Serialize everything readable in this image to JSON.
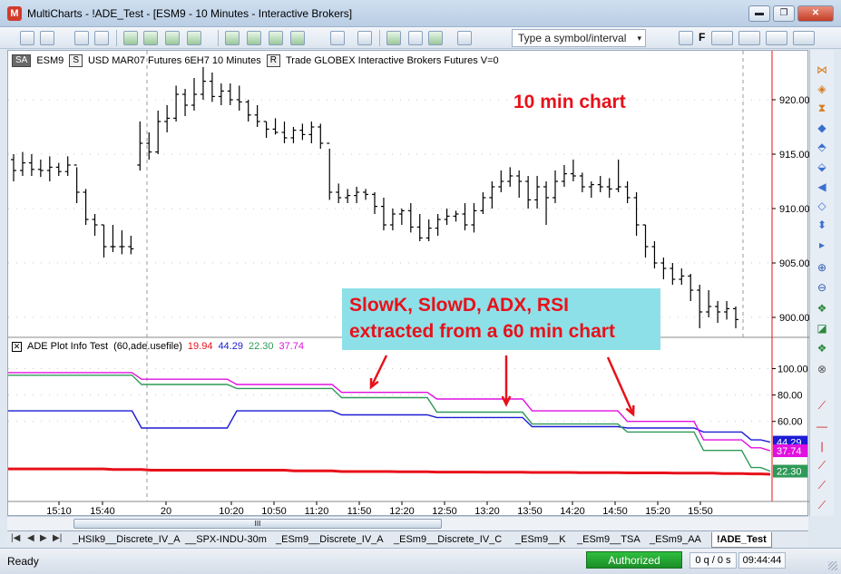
{
  "window": {
    "title": "MultiCharts - !ADE_Test - [ESM9 - 10 Minutes - Interactive Brokers]",
    "app_icon": "multicharts-logo-icon",
    "minimize": "▬",
    "restore": "❐",
    "close": "✕"
  },
  "toolbar": {
    "symbol_placeholder": "Type a symbol/interval",
    "dropdown_glyph": "▾",
    "extra_label": "F"
  },
  "chart_header": {
    "sa_button": "SA",
    "symbol": "ESM9",
    "s_button": "S",
    "description": "USD MAR07  Futures 6EH7  10 Minutes",
    "r_button": "R",
    "details": "Trade  GLOBEX  Interactive Brokers  Futures  V=0"
  },
  "annotations": {
    "title": "10 min chart",
    "box_line1": "SlowK, SlowD, ADX, RSI",
    "box_line2": "extracted from a 60 min chart"
  },
  "indicator": {
    "close_glyph": "✕",
    "name": "ADE Plot Info Test",
    "params": "(60,ade.usefile)",
    "values": [
      "19.94",
      "44.29",
      "22.30",
      "37.74"
    ],
    "colors": [
      "#e8111a",
      "#1b1bd6",
      "#2e9a58",
      "#e010e0"
    ]
  },
  "price_axis": [
    "920.00",
    "915.00",
    "910.00",
    "905.00",
    "900.00"
  ],
  "indicator_axis": [
    "100.00",
    "80.00",
    "60.00"
  ],
  "indicator_tags": {
    "adx": "44.29",
    "rsi": "37.74",
    "slowd": "22.30"
  },
  "time_axis": [
    "15:10",
    "15:40",
    "20",
    "10:20",
    "10:50",
    "11:20",
    "11:50",
    "12:20",
    "12:50",
    "13:20",
    "13:50",
    "14:20",
    "14:50",
    "15:20",
    "15:50"
  ],
  "chart_data": [
    {
      "type": "bar",
      "title": "",
      "xlabel": "",
      "ylabel": "",
      "ylim": [
        898.5,
        922.5
      ],
      "grid": true,
      "note": "OHLC price bars, ESM9 10 minutes",
      "bars": [
        [
          914.5,
          915.0,
          912.5,
          913.5
        ],
        [
          913.5,
          915.2,
          913.0,
          914.2
        ],
        [
          914.2,
          915.0,
          913.0,
          913.6
        ],
        [
          913.6,
          914.5,
          912.9,
          913.5
        ],
        [
          913.5,
          914.8,
          912.5,
          913.8
        ],
        [
          913.8,
          914.2,
          913.0,
          913.4
        ],
        [
          913.4,
          914.8,
          913.0,
          914.0
        ],
        [
          914.0,
          913.8,
          910.5,
          911.5
        ],
        [
          911.5,
          911.8,
          908.5,
          909.0
        ],
        [
          909.0,
          909.5,
          907.5,
          908.5
        ],
        [
          908.5,
          908.5,
          905.5,
          906.5
        ],
        [
          906.5,
          908.5,
          906.0,
          906.5
        ],
        [
          906.5,
          908.0,
          905.8,
          906.5
        ],
        [
          906.5,
          907.5,
          905.8,
          906.3
        ],
        [
          914.0,
          918.0,
          913.5,
          916.0
        ],
        [
          916.0,
          917.0,
          914.5,
          915.2
        ],
        [
          915.2,
          919.0,
          915.0,
          918.0
        ],
        [
          918.0,
          919.5,
          917.0,
          918.3
        ],
        [
          918.3,
          921.3,
          918.0,
          920.5
        ],
        [
          920.5,
          921.0,
          918.5,
          919.5
        ],
        [
          919.5,
          922.0,
          919.0,
          920.5
        ],
        [
          920.5,
          923.0,
          920.0,
          921.7
        ],
        [
          921.7,
          922.5,
          919.8,
          920.3
        ],
        [
          920.3,
          921.5,
          919.5,
          920.8
        ],
        [
          920.8,
          921.5,
          919.5,
          920.0
        ],
        [
          920.0,
          921.3,
          919.0,
          919.8
        ],
        [
          919.8,
          920.0,
          918.0,
          918.6
        ],
        [
          918.6,
          919.5,
          917.5,
          918.0
        ],
        [
          918.0,
          918.0,
          916.5,
          917.3
        ],
        [
          917.3,
          918.3,
          916.8,
          917.0
        ],
        [
          917.0,
          918.0,
          916.0,
          916.5
        ],
        [
          916.5,
          917.5,
          916.0,
          917.2
        ],
        [
          917.2,
          917.8,
          916.3,
          916.8
        ],
        [
          916.8,
          918.0,
          916.0,
          917.5
        ],
        [
          917.5,
          917.8,
          915.5,
          916.0
        ],
        [
          916.0,
          915.5,
          910.8,
          911.5
        ],
        [
          911.5,
          912.3,
          910.5,
          911.0
        ],
        [
          911.0,
          911.8,
          910.5,
          911.2
        ],
        [
          911.2,
          912.0,
          910.5,
          911.5
        ],
        [
          911.5,
          911.8,
          910.8,
          911.3
        ],
        [
          911.3,
          911.5,
          909.5,
          910.2
        ],
        [
          910.2,
          911.0,
          908.0,
          908.5
        ],
        [
          908.5,
          910.0,
          908.0,
          909.5
        ],
        [
          909.5,
          910.0,
          908.5,
          909.8
        ],
        [
          909.8,
          910.5,
          907.8,
          908.3
        ],
        [
          908.3,
          909.5,
          907.0,
          907.3
        ],
        [
          907.3,
          909.0,
          907.0,
          908.2
        ],
        [
          908.2,
          909.5,
          907.5,
          909.0
        ],
        [
          909.0,
          910.0,
          908.5,
          909.3
        ],
        [
          909.3,
          909.8,
          908.8,
          909.5
        ],
        [
          909.5,
          910.5,
          908.0,
          908.5
        ],
        [
          908.5,
          910.5,
          907.8,
          909.8
        ],
        [
          909.8,
          911.5,
          909.5,
          911.0
        ],
        [
          911.0,
          912.5,
          910.0,
          912.0
        ],
        [
          912.0,
          913.5,
          911.5,
          912.5
        ],
        [
          912.5,
          913.8,
          912.0,
          913.0
        ],
        [
          913.0,
          913.5,
          911.0,
          912.5
        ],
        [
          912.5,
          913.0,
          910.0,
          910.8
        ],
        [
          910.8,
          913.0,
          910.0,
          912.0
        ],
        [
          912.0,
          912.5,
          908.5,
          911.0
        ],
        [
          911.0,
          913.5,
          910.5,
          912.5
        ],
        [
          912.5,
          914.0,
          912.0,
          913.2
        ],
        [
          913.2,
          914.5,
          912.5,
          913.0
        ],
        [
          913.0,
          913.3,
          911.5,
          912.0
        ],
        [
          912.0,
          912.5,
          911.0,
          912.2
        ],
        [
          912.2,
          913.0,
          911.5,
          912.0
        ],
        [
          912.0,
          912.8,
          911.0,
          911.8
        ],
        [
          911.8,
          914.5,
          911.5,
          912.0
        ],
        [
          912.0,
          912.5,
          910.5,
          911.0
        ],
        [
          911.0,
          911.5,
          907.5,
          908.5
        ],
        [
          908.5,
          908.5,
          905.5,
          906.5
        ],
        [
          906.5,
          907.0,
          904.5,
          905.0
        ],
        [
          905.0,
          905.5,
          903.5,
          904.5
        ],
        [
          904.5,
          905.0,
          903.0,
          903.5
        ],
        [
          903.5,
          904.5,
          903.0,
          903.8
        ],
        [
          903.8,
          904.0,
          901.5,
          902.5
        ],
        [
          902.5,
          903.0,
          899.0,
          900.5
        ],
        [
          900.5,
          902.5,
          900.0,
          901.0
        ],
        [
          901.0,
          901.5,
          899.5,
          900.5
        ],
        [
          900.5,
          901.5,
          899.8,
          900.8
        ],
        [
          900.8,
          901.0,
          899.0,
          899.8
        ]
      ]
    },
    {
      "type": "line",
      "title": "",
      "xlabel": "",
      "ylabel": "",
      "ylim": [
        0,
        110
      ],
      "grid": true,
      "x": [
        0,
        1,
        2,
        3,
        4,
        5,
        6,
        7,
        8,
        9,
        10,
        11,
        12,
        13,
        14,
        15,
        16,
        17,
        18,
        19,
        20,
        21,
        22,
        23,
        24,
        25,
        26,
        27,
        28,
        29,
        30,
        31,
        32,
        33,
        34,
        35,
        36,
        37,
        38,
        39,
        40,
        41,
        42,
        43,
        44,
        45,
        46,
        47,
        48,
        49,
        50,
        51,
        52,
        53,
        54,
        55,
        56,
        57,
        58,
        59,
        60,
        61,
        62,
        63,
        64,
        65,
        66,
        67,
        68,
        69,
        70,
        71,
        72,
        73,
        74,
        75,
        76,
        77,
        78,
        79,
        80
      ],
      "series": [
        {
          "color": "#e8111a",
          "values": [
            24,
            24,
            24,
            24,
            24,
            24,
            24,
            24,
            24,
            24,
            24,
            23.5,
            23.5,
            23.5,
            23.5,
            23,
            23,
            23,
            23,
            23,
            23,
            23,
            23,
            23,
            23,
            23,
            23,
            23,
            23,
            23,
            22.5,
            22.5,
            22.5,
            22.5,
            22.5,
            22,
            22,
            22,
            22,
            22,
            22,
            21.8,
            21.8,
            21.8,
            21.8,
            21.6,
            21.6,
            21.6,
            21.6,
            21.6,
            21.5,
            21.5,
            21.5,
            21.5,
            21.5,
            21.3,
            21.3,
            21.3,
            21.3,
            21.3,
            21.2,
            21.2,
            21.2,
            21.2,
            21.2,
            21.0,
            21.0,
            21.0,
            21.0,
            21.0,
            20.8,
            20.8,
            20.8,
            20.8,
            20.8,
            20.5,
            20.5,
            20.5,
            20.2,
            20.2,
            19.94
          ]
        },
        {
          "color": "#1b1bd6",
          "values": [
            68,
            68,
            68,
            68,
            68,
            68,
            68,
            68,
            68,
            68,
            68,
            68,
            68,
            68,
            55,
            55,
            55,
            55,
            55,
            55,
            55,
            55,
            55,
            55,
            68,
            68,
            68,
            68,
            68,
            68,
            68,
            68,
            68,
            68,
            68,
            65,
            65,
            65,
            65,
            65,
            65,
            65,
            65,
            65,
            65,
            63,
            63,
            63,
            63,
            63,
            63,
            63,
            63,
            63,
            63,
            56,
            56,
            56,
            56,
            56,
            56,
            56,
            56,
            56,
            56,
            55,
            55,
            55,
            55,
            55,
            55,
            55,
            55,
            52,
            52,
            52,
            52,
            52,
            46,
            46,
            44.29
          ]
        },
        {
          "color": "#2e9a58",
          "values": [
            95,
            95,
            95,
            95,
            95,
            95,
            95,
            95,
            95,
            95,
            95,
            95,
            95,
            95,
            88,
            88,
            88,
            88,
            88,
            88,
            88,
            88,
            88,
            88,
            85,
            85,
            85,
            85,
            85,
            85,
            85,
            85,
            85,
            85,
            85,
            78,
            78,
            78,
            78,
            78,
            78,
            78,
            78,
            78,
            78,
            67,
            67,
            67,
            67,
            67,
            67,
            67,
            67,
            67,
            67,
            58,
            58,
            58,
            58,
            58,
            58,
            58,
            58,
            58,
            58,
            52,
            52,
            52,
            52,
            52,
            52,
            52,
            52,
            38,
            38,
            38,
            38,
            38,
            25,
            25,
            22.3
          ]
        },
        {
          "color": "#e010e0",
          "values": [
            97,
            97,
            97,
            97,
            97,
            97,
            97,
            97,
            97,
            97,
            97,
            97,
            97,
            97,
            92,
            92,
            92,
            92,
            92,
            92,
            92,
            92,
            92,
            92,
            88,
            88,
            88,
            88,
            88,
            88,
            88,
            88,
            88,
            88,
            88,
            82,
            82,
            82,
            82,
            82,
            82,
            82,
            82,
            82,
            82,
            77,
            77,
            77,
            77,
            77,
            77,
            77,
            77,
            77,
            77,
            68,
            68,
            68,
            68,
            68,
            68,
            68,
            68,
            68,
            68,
            60,
            60,
            60,
            60,
            60,
            60,
            60,
            60,
            46,
            46,
            46,
            46,
            46,
            40,
            40,
            37.74
          ]
        }
      ]
    }
  ],
  "tabs": {
    "nav": [
      "|◀",
      "◀",
      "▶",
      "▶|"
    ],
    "items": [
      "_HSIk9__Discrete_IV_A",
      "__SPX-INDU-30m",
      "_ESm9__Discrete_IV_A",
      "_ESm9__Discrete_IV_C",
      "_ESm9__K",
      "_ESm9__TSA",
      "_ESm9_AA",
      "!ADE_Test"
    ]
  },
  "scrollbar": {
    "thumb_label": "III"
  },
  "status": {
    "ready": "Ready",
    "authorized": "Authorized",
    "queue": "0 q / 0 s",
    "time": "09:44:44"
  },
  "right_tools": [
    "⋈",
    "◈",
    "⧗",
    "◆",
    "⬘",
    "⬙",
    "◀",
    "◇",
    "⬍",
    "▸",
    "⊕",
    "⊖",
    "❖",
    "◪",
    "❖",
    "⊗",
    "⟋",
    "—",
    "|",
    "⟋",
    "⟋",
    "⟋",
    "⟋"
  ]
}
